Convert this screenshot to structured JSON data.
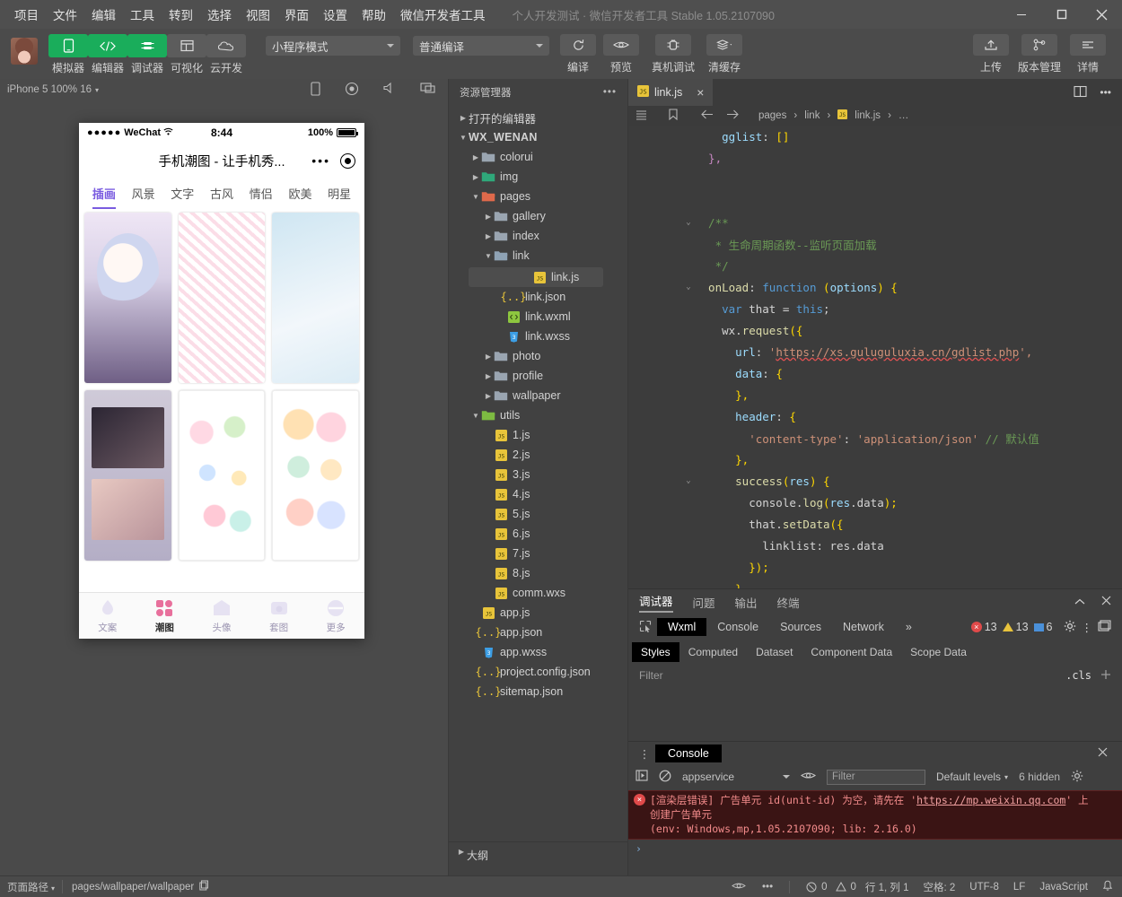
{
  "window": {
    "menu": [
      "项目",
      "文件",
      "编辑",
      "工具",
      "转到",
      "选择",
      "视图",
      "界面",
      "设置",
      "帮助",
      "微信开发者工具"
    ],
    "title": "个人开发测试 · 微信开发者工具 Stable 1.05.2107090"
  },
  "toolbar": {
    "buttons": [
      {
        "label": "模拟器",
        "icon": "phone-icon",
        "active": true
      },
      {
        "label": "编辑器",
        "icon": "code-icon",
        "active": true
      },
      {
        "label": "调试器",
        "icon": "bug-icon",
        "active": true
      },
      {
        "label": "可视化",
        "icon": "layout-icon",
        "active": false
      },
      {
        "label": "云开发",
        "icon": "cloud-icon",
        "active": false
      }
    ],
    "mode_select": "小程序模式",
    "compile_select": "普通编译",
    "actions": [
      {
        "label": "编译",
        "icon": "refresh-icon"
      },
      {
        "label": "预览",
        "icon": "eye-icon"
      }
    ],
    "right_actions": [
      {
        "label": "真机调试",
        "icon": "device-debug-icon"
      },
      {
        "label": "清缓存",
        "icon": "layers-icon"
      }
    ],
    "far_right": [
      {
        "label": "上传",
        "icon": "upload-icon"
      },
      {
        "label": "版本管理",
        "icon": "branch-icon"
      },
      {
        "label": "详情",
        "icon": "details-icon"
      }
    ]
  },
  "simulator": {
    "device_label": "iPhone 5 100% 16",
    "status": {
      "carrier": "WeChat",
      "time": "8:44",
      "battery": "100%"
    },
    "nav_title": "手机潮图 - 让手机秀...",
    "category_tabs": [
      "插画",
      "风景",
      "文字",
      "古风",
      "情侣",
      "欧美",
      "明星"
    ],
    "active_category": "插画",
    "tabbar": [
      {
        "label": "文案",
        "icon": "droplet-icon",
        "active": false
      },
      {
        "label": "潮图",
        "icon": "grid-icon",
        "active": true
      },
      {
        "label": "头像",
        "icon": "face-icon",
        "active": false
      },
      {
        "label": "套图",
        "icon": "photo-icon",
        "active": false
      },
      {
        "label": "更多",
        "icon": "more-icon",
        "active": false
      }
    ]
  },
  "explorer": {
    "title": "资源管理器",
    "menu_icon": "ellipsis-icon",
    "open_editors": "打开的编辑器",
    "project": "WX_WENAN",
    "tree": [
      {
        "name": "colorui",
        "type": "folder",
        "depth": 1,
        "open": false,
        "color": "#9aa5b1"
      },
      {
        "name": "img",
        "type": "folder",
        "depth": 1,
        "open": false,
        "color": "#2fa87a"
      },
      {
        "name": "pages",
        "type": "folder",
        "depth": 1,
        "open": true,
        "color": "#e06a4b"
      },
      {
        "name": "gallery",
        "type": "folder",
        "depth": 2,
        "open": false,
        "color": "#9aa5b1"
      },
      {
        "name": "index",
        "type": "folder",
        "depth": 2,
        "open": false,
        "color": "#9aa5b1"
      },
      {
        "name": "link",
        "type": "folder",
        "depth": 2,
        "open": true,
        "color": "#8fa3b5"
      },
      {
        "name": "link.js",
        "type": "js",
        "depth": 3,
        "selected": true
      },
      {
        "name": "link.json",
        "type": "json",
        "depth": 3
      },
      {
        "name": "link.wxml",
        "type": "wxml",
        "depth": 3
      },
      {
        "name": "link.wxss",
        "type": "wxss",
        "depth": 3
      },
      {
        "name": "photo",
        "type": "folder",
        "depth": 2,
        "open": false,
        "color": "#9aa5b1"
      },
      {
        "name": "profile",
        "type": "folder",
        "depth": 2,
        "open": false,
        "color": "#9aa5b1"
      },
      {
        "name": "wallpaper",
        "type": "folder",
        "depth": 2,
        "open": false,
        "color": "#9aa5b1"
      },
      {
        "name": "utils",
        "type": "folder",
        "depth": 1,
        "open": true,
        "color": "#7dbb42"
      },
      {
        "name": "1.js",
        "type": "js",
        "depth": 2
      },
      {
        "name": "2.js",
        "type": "js",
        "depth": 2
      },
      {
        "name": "3.js",
        "type": "js",
        "depth": 2
      },
      {
        "name": "4.js",
        "type": "js",
        "depth": 2
      },
      {
        "name": "5.js",
        "type": "js",
        "depth": 2
      },
      {
        "name": "6.js",
        "type": "js",
        "depth": 2
      },
      {
        "name": "7.js",
        "type": "js",
        "depth": 2
      },
      {
        "name": "8.js",
        "type": "js",
        "depth": 2
      },
      {
        "name": "comm.wxs",
        "type": "js",
        "depth": 2
      },
      {
        "name": "app.js",
        "type": "js",
        "depth": 1
      },
      {
        "name": "app.json",
        "type": "json",
        "depth": 1
      },
      {
        "name": "app.wxss",
        "type": "wxss",
        "depth": 1
      },
      {
        "name": "project.config.json",
        "type": "json",
        "depth": 1
      },
      {
        "name": "sitemap.json",
        "type": "json",
        "depth": 1
      }
    ],
    "outline": "大纲"
  },
  "editor": {
    "tab": "link.js",
    "tab_icon": "js-icon",
    "breadcrumb": [
      "pages",
      "link",
      "link.js",
      "…"
    ],
    "lines": [
      {
        "num": "",
        "fold": "",
        "tokens": [
          {
            "t": "    ",
            "c": "k-txt"
          },
          {
            "t": "gglist",
            "c": "k-key"
          },
          {
            "t": ": ",
            "c": "k-txt"
          },
          {
            "t": "[]",
            "c": "k-pl"
          }
        ]
      },
      {
        "num": "",
        "fold": "",
        "tokens": [
          {
            "t": "  },",
            "c": "k-pnk"
          }
        ]
      },
      {
        "num": "",
        "fold": "",
        "tokens": []
      },
      {
        "num": "",
        "fold": "",
        "tokens": []
      },
      {
        "num": "",
        "fold": "v",
        "tokens": [
          {
            "t": "  /**",
            "c": "k-cmt"
          }
        ]
      },
      {
        "num": "",
        "fold": "",
        "tokens": [
          {
            "t": "   * 生命周期函数--监听页面加载",
            "c": "k-cmt"
          }
        ]
      },
      {
        "num": "",
        "fold": "",
        "tokens": [
          {
            "t": "   */",
            "c": "k-cmt"
          }
        ]
      },
      {
        "num": "",
        "fold": "v",
        "tokens": [
          {
            "t": "  onLoad",
            "c": "k-ylw"
          },
          {
            "t": ": ",
            "c": "k-txt"
          },
          {
            "t": "function",
            "c": "k-kw2"
          },
          {
            "t": " (",
            "c": "k-pl"
          },
          {
            "t": "options",
            "c": "k-prm"
          },
          {
            "t": ") {",
            "c": "k-pl"
          }
        ]
      },
      {
        "num": "",
        "fold": "",
        "tokens": [
          {
            "t": "    ",
            "c": "k-txt"
          },
          {
            "t": "var",
            "c": "k-kw2"
          },
          {
            "t": " that = ",
            "c": "k-txt"
          },
          {
            "t": "this",
            "c": "k-kw2"
          },
          {
            "t": ";",
            "c": "k-txt"
          }
        ]
      },
      {
        "num": "",
        "fold": "",
        "tokens": [
          {
            "t": "    wx.",
            "c": "k-txt"
          },
          {
            "t": "request",
            "c": "k-ylw"
          },
          {
            "t": "({",
            "c": "k-pl"
          }
        ]
      },
      {
        "num": "",
        "fold": "",
        "tokens": [
          {
            "t": "      url",
            "c": "k-key"
          },
          {
            "t": ": ",
            "c": "k-txt"
          },
          {
            "t": "'",
            "c": "k-str"
          },
          {
            "t": "https://xs.guluguluxia.cn/gdlist.php",
            "c": "k-str url-u"
          },
          {
            "t": "',",
            "c": "k-str"
          }
        ]
      },
      {
        "num": "",
        "fold": "",
        "tokens": [
          {
            "t": "      data",
            "c": "k-key"
          },
          {
            "t": ": ",
            "c": "k-txt"
          },
          {
            "t": "{",
            "c": "k-pl"
          }
        ]
      },
      {
        "num": "",
        "fold": "",
        "tokens": [
          {
            "t": "      },",
            "c": "k-pl"
          }
        ]
      },
      {
        "num": "",
        "fold": "",
        "tokens": [
          {
            "t": "      header",
            "c": "k-key"
          },
          {
            "t": ": ",
            "c": "k-txt"
          },
          {
            "t": "{",
            "c": "k-pl"
          }
        ]
      },
      {
        "num": "",
        "fold": "",
        "tokens": [
          {
            "t": "        ",
            "c": "k-txt"
          },
          {
            "t": "'content-type'",
            "c": "k-str"
          },
          {
            "t": ": ",
            "c": "k-txt"
          },
          {
            "t": "'application/json'",
            "c": "k-str"
          },
          {
            "t": " // 默认值",
            "c": "k-cmt"
          }
        ]
      },
      {
        "num": "",
        "fold": "",
        "tokens": [
          {
            "t": "      },",
            "c": "k-pl"
          }
        ]
      },
      {
        "num": "",
        "fold": "v",
        "tokens": [
          {
            "t": "      ",
            "c": "k-txt"
          },
          {
            "t": "success",
            "c": "k-ylw"
          },
          {
            "t": "(",
            "c": "k-pl"
          },
          {
            "t": "res",
            "c": "k-prm"
          },
          {
            "t": ") {",
            "c": "k-pl"
          }
        ]
      },
      {
        "num": "",
        "fold": "",
        "tokens": [
          {
            "t": "        console.",
            "c": "k-txt"
          },
          {
            "t": "log",
            "c": "k-ylw"
          },
          {
            "t": "(",
            "c": "k-pl"
          },
          {
            "t": "res",
            "c": "k-prm"
          },
          {
            "t": ".data",
            "c": "k-txt"
          },
          {
            "t": ");",
            "c": "k-pl"
          }
        ]
      },
      {
        "num": "",
        "fold": "",
        "tokens": [
          {
            "t": "        that.",
            "c": "k-txt"
          },
          {
            "t": "setData",
            "c": "k-ylw"
          },
          {
            "t": "({",
            "c": "k-pl"
          }
        ]
      },
      {
        "num": "",
        "fold": "",
        "tokens": [
          {
            "t": "          linklist: res.data",
            "c": "k-txt"
          }
        ]
      },
      {
        "num": "",
        "fold": "",
        "tokens": [
          {
            "t": "        });",
            "c": "k-pl"
          }
        ]
      },
      {
        "num": "",
        "fold": "",
        "tokens": [
          {
            "t": "      }",
            "c": "k-pl"
          }
        ]
      },
      {
        "num": "",
        "fold": "",
        "tokens": [
          {
            "t": "    })",
            "c": "k-pnk"
          }
        ]
      }
    ]
  },
  "debugger": {
    "panel_tabs": [
      "调试器",
      "问题",
      "输出",
      "终端"
    ],
    "active_panel_tab": "调试器",
    "devtool_tabs": [
      "Wxml",
      "Console",
      "Sources",
      "Network"
    ],
    "active_devtool_tab": "Wxml",
    "overflow": "»",
    "counts": {
      "errors": "13",
      "warnings": "13",
      "info": "6"
    },
    "style_tabs": [
      "Styles",
      "Computed",
      "Dataset",
      "Component Data",
      "Scope Data"
    ],
    "active_style_tab": "Styles",
    "filter_placeholder": "Filter",
    "cls_button": ".cls"
  },
  "console": {
    "title": "Console",
    "context": "appservice",
    "filter_placeholder": "Filter",
    "levels": "Default levels",
    "hidden": "6 hidden",
    "message_line1": "[渲染层错误] 广告单元 id(unit-id) 为空，请先在 '",
    "message_link": "https://mp.weixin.qq.com",
    "message_line1b": "' 上",
    "message_line2": "创建广告单元",
    "message_line3": "(env: Windows,mp,1.05.2107090; lib: 2.16.0)",
    "prompt": "›"
  },
  "status_bar": {
    "page_path_label": "页面路径",
    "page_path": "pages/wallpaper/wallpaper",
    "problems": {
      "errors": "0",
      "warnings": "0"
    },
    "cursor": "行 1, 列 1",
    "spaces": "空格: 2",
    "encoding": "UTF-8",
    "eol": "LF",
    "language": "JavaScript"
  },
  "colors": {
    "accent_green": "#1aad5b",
    "error_red": "#e04a4a",
    "warn_yellow": "#e8c33c",
    "purple": "#7a5ce0"
  }
}
